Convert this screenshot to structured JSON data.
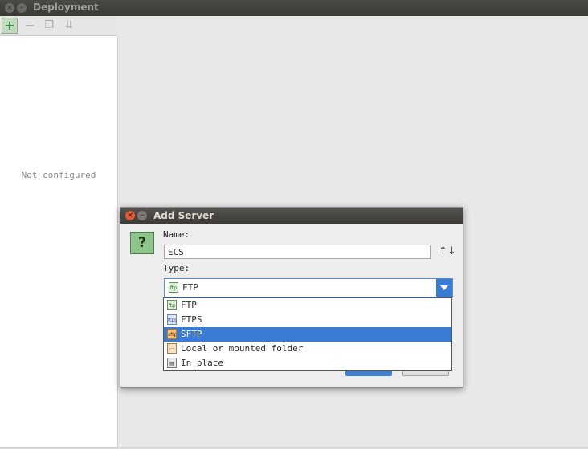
{
  "window": {
    "title": "Deployment"
  },
  "toolbar": {
    "add_icon": "plus-icon",
    "remove_icon": "minus-icon",
    "copy_icon": "copy-icon",
    "import_icon": "import-icon"
  },
  "sidebar": {
    "empty_text": "Not configured"
  },
  "dialog": {
    "title": "Add Server",
    "name_label": "Name:",
    "name_value": "ECS",
    "type_label": "Type:",
    "type_value": "FTP",
    "type_options": [
      {
        "label": "FTP",
        "icon": "ftp-icon",
        "selected": false
      },
      {
        "label": "FTPS",
        "icon": "ftps-icon",
        "selected": false
      },
      {
        "label": "SFTP",
        "icon": "sftp-icon",
        "selected": true
      },
      {
        "label": "Local or mounted folder",
        "icon": "folder-icon",
        "selected": false
      },
      {
        "label": "In place",
        "icon": "in-place-icon",
        "selected": false
      }
    ]
  },
  "colors": {
    "accent": "#3a7bd5",
    "titlebar": "#3c3b37",
    "close": "#e05b2f"
  }
}
